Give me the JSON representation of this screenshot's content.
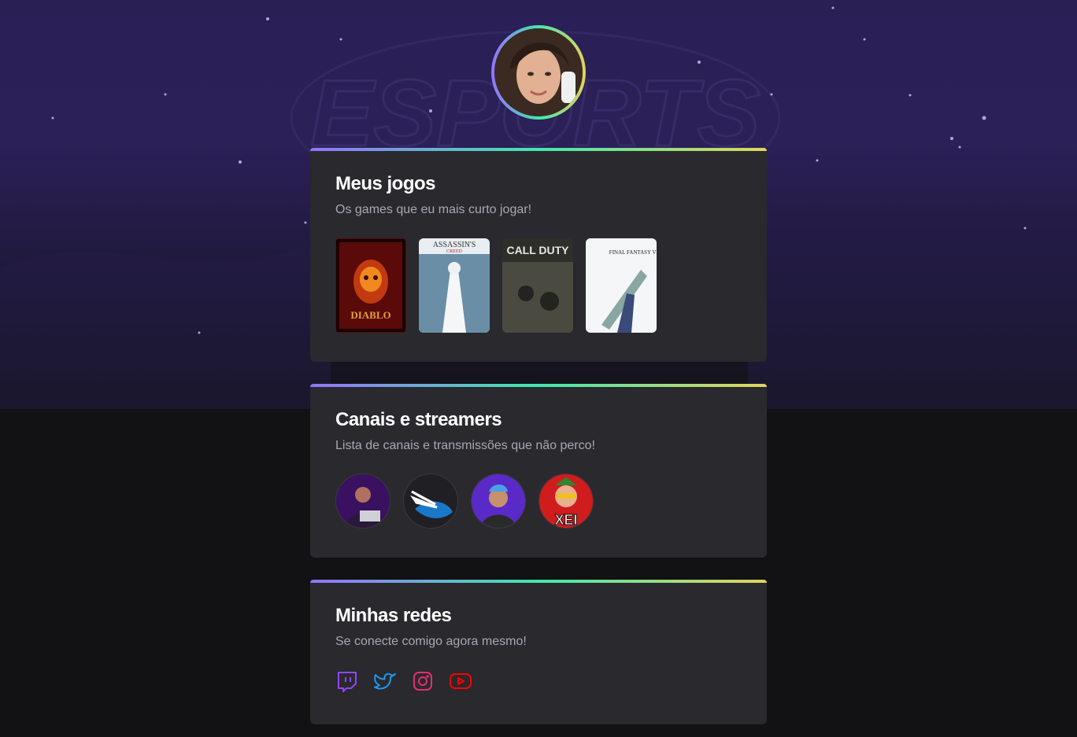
{
  "profile": {
    "avatar_icon": "user-photo-icon"
  },
  "games_card": {
    "title": "Meus jogos",
    "subtitle": "Os games que eu mais curto jogar!",
    "games": [
      {
        "name": "Diablo II",
        "cover_text": "DIABLO",
        "icon": "diablo-cover"
      },
      {
        "name": "Assassin's Creed",
        "cover_text": "ASSASSIN'S",
        "cover_sub": "CREED",
        "icon": "assassins-creed-cover"
      },
      {
        "name": "Call of Duty",
        "cover_text": "CALL DUTY",
        "icon": "call-of-duty-cover"
      },
      {
        "name": "Final Fantasy VII",
        "cover_text": "FINAL FANTASY VII",
        "icon": "final-fantasy-cover"
      }
    ]
  },
  "streamers_card": {
    "title": "Canais e streamers",
    "subtitle": "Lista de canais e transmissões que não perco!",
    "streamers": [
      {
        "icon": "streamer-1-avatar"
      },
      {
        "icon": "streamer-2-avatar"
      },
      {
        "icon": "streamer-3-avatar"
      },
      {
        "icon": "streamer-4-avatar",
        "text": "XEI"
      }
    ]
  },
  "social_card": {
    "title": "Minhas redes",
    "subtitle": "Se conecte comigo agora mesmo!",
    "links": [
      {
        "icon": "twitch-icon",
        "color": "#9146ff"
      },
      {
        "icon": "twitter-icon",
        "color": "#1d9bf0"
      },
      {
        "icon": "instagram-icon",
        "color": "#e1306c"
      },
      {
        "icon": "youtube-icon",
        "color": "#ff0000"
      }
    ]
  },
  "colors": {
    "background": "#121214",
    "card": "#29292e",
    "gradient": [
      "#9572fc",
      "#43e7ad",
      "#e2d45c"
    ]
  }
}
